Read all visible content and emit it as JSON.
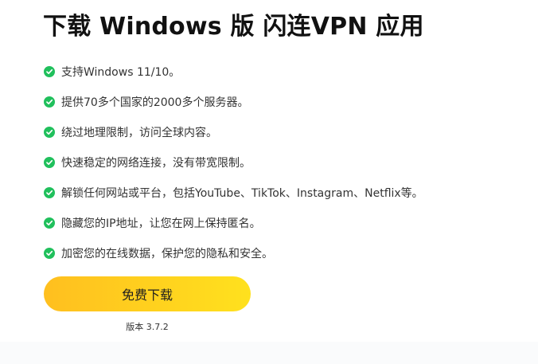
{
  "title": "下载 Windows 版 闪连VPN 应用",
  "features": [
    "支持Windows 11/10。",
    "提供70多个国家的2000多个服务器。",
    "绕过地理限制，访问全球内容。",
    "快速稳定的网络连接，没有带宽限制。",
    "解锁任何网站或平台，包括YouTube、TikTok、Instagram、Netflix等。",
    "隐藏您的IP地址，让您在网上保持匿名。",
    "加密您的在线数据，保护您的隐私和安全。"
  ],
  "download_button": {
    "label": "免费下载"
  },
  "version": "版本 3.7.2",
  "colors": {
    "check": "#20c05c",
    "button_start": "#ffbf1f",
    "button_end": "#ffe11e",
    "title": "#111111",
    "text": "#333333"
  },
  "icons": {
    "feature": "check-circle-icon"
  }
}
